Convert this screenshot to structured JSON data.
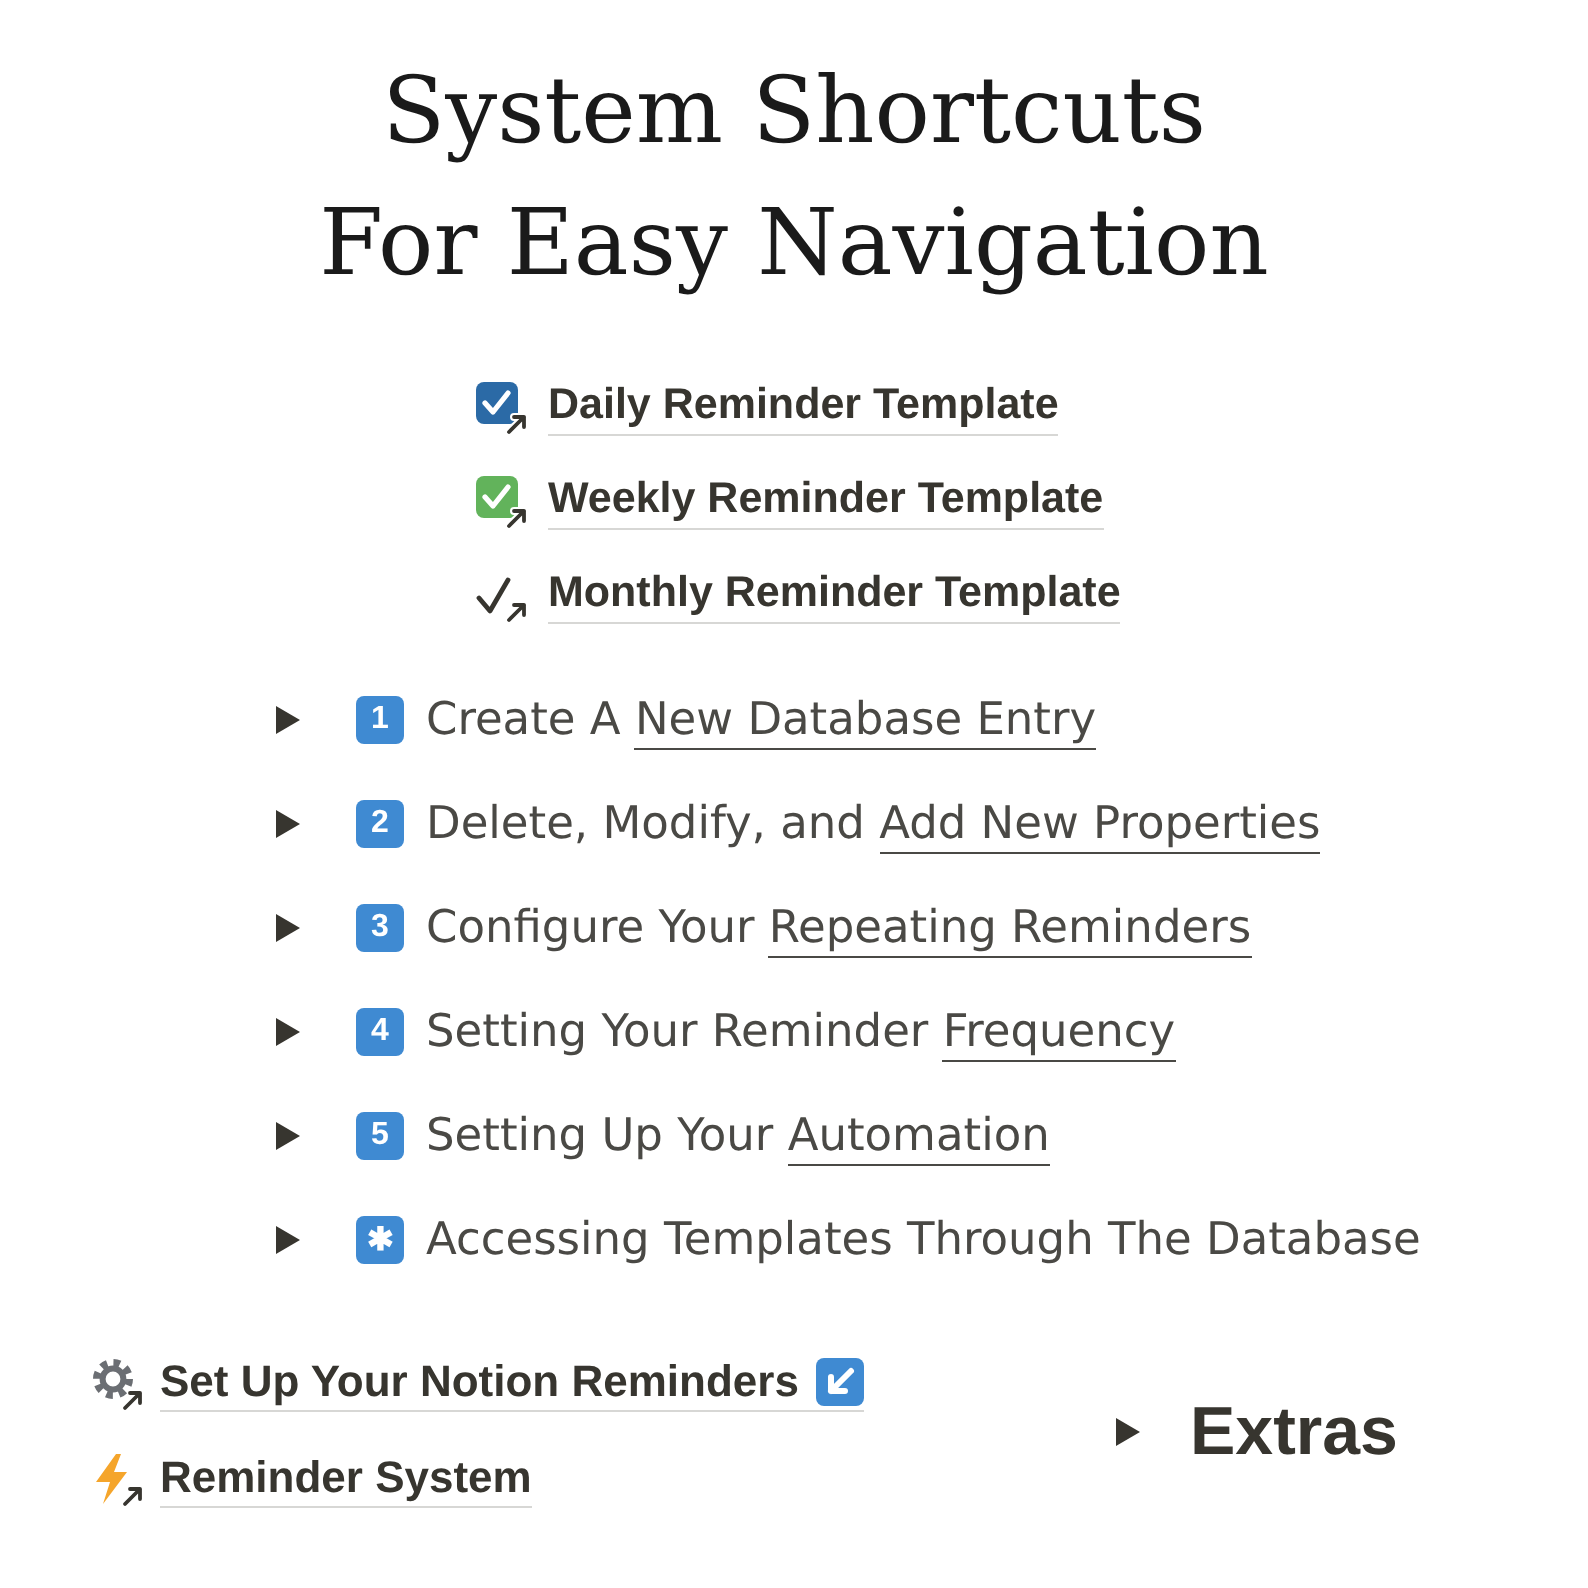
{
  "title": {
    "lines": [
      "System Shortcuts",
      "For Easy Navigation"
    ]
  },
  "template_links": [
    {
      "label": "Daily Reminder Template"
    },
    {
      "label": "Weekly Reminder Template"
    },
    {
      "label": "Monthly Reminder Template"
    }
  ],
  "toggles": [
    {
      "expanded": false,
      "badge": "1",
      "text": "Create A",
      "link": "New Database Entry"
    },
    {
      "expanded": false,
      "badge": "2",
      "text": "Delete, Modify, and",
      "link": "Add New Properties"
    },
    {
      "expanded": false,
      "badge": "3",
      "text": "Configure Your",
      "link": "Repeating Reminders"
    },
    {
      "expanded": false,
      "badge": "4",
      "text": "Setting Your Reminder",
      "link": "Frequency"
    },
    {
      "expanded": false,
      "badge": "5",
      "text": "Setting Up Your",
      "link": "Automation"
    },
    {
      "expanded": false,
      "badge": "✱",
      "text": "Accessing Templates Through The Database"
    }
  ],
  "page_links": [
    {
      "label": "Set Up Your Notion Reminders"
    },
    {
      "label": "Reminder System"
    }
  ],
  "extras_toggle": {
    "label": "Extras",
    "expanded": false
  }
}
